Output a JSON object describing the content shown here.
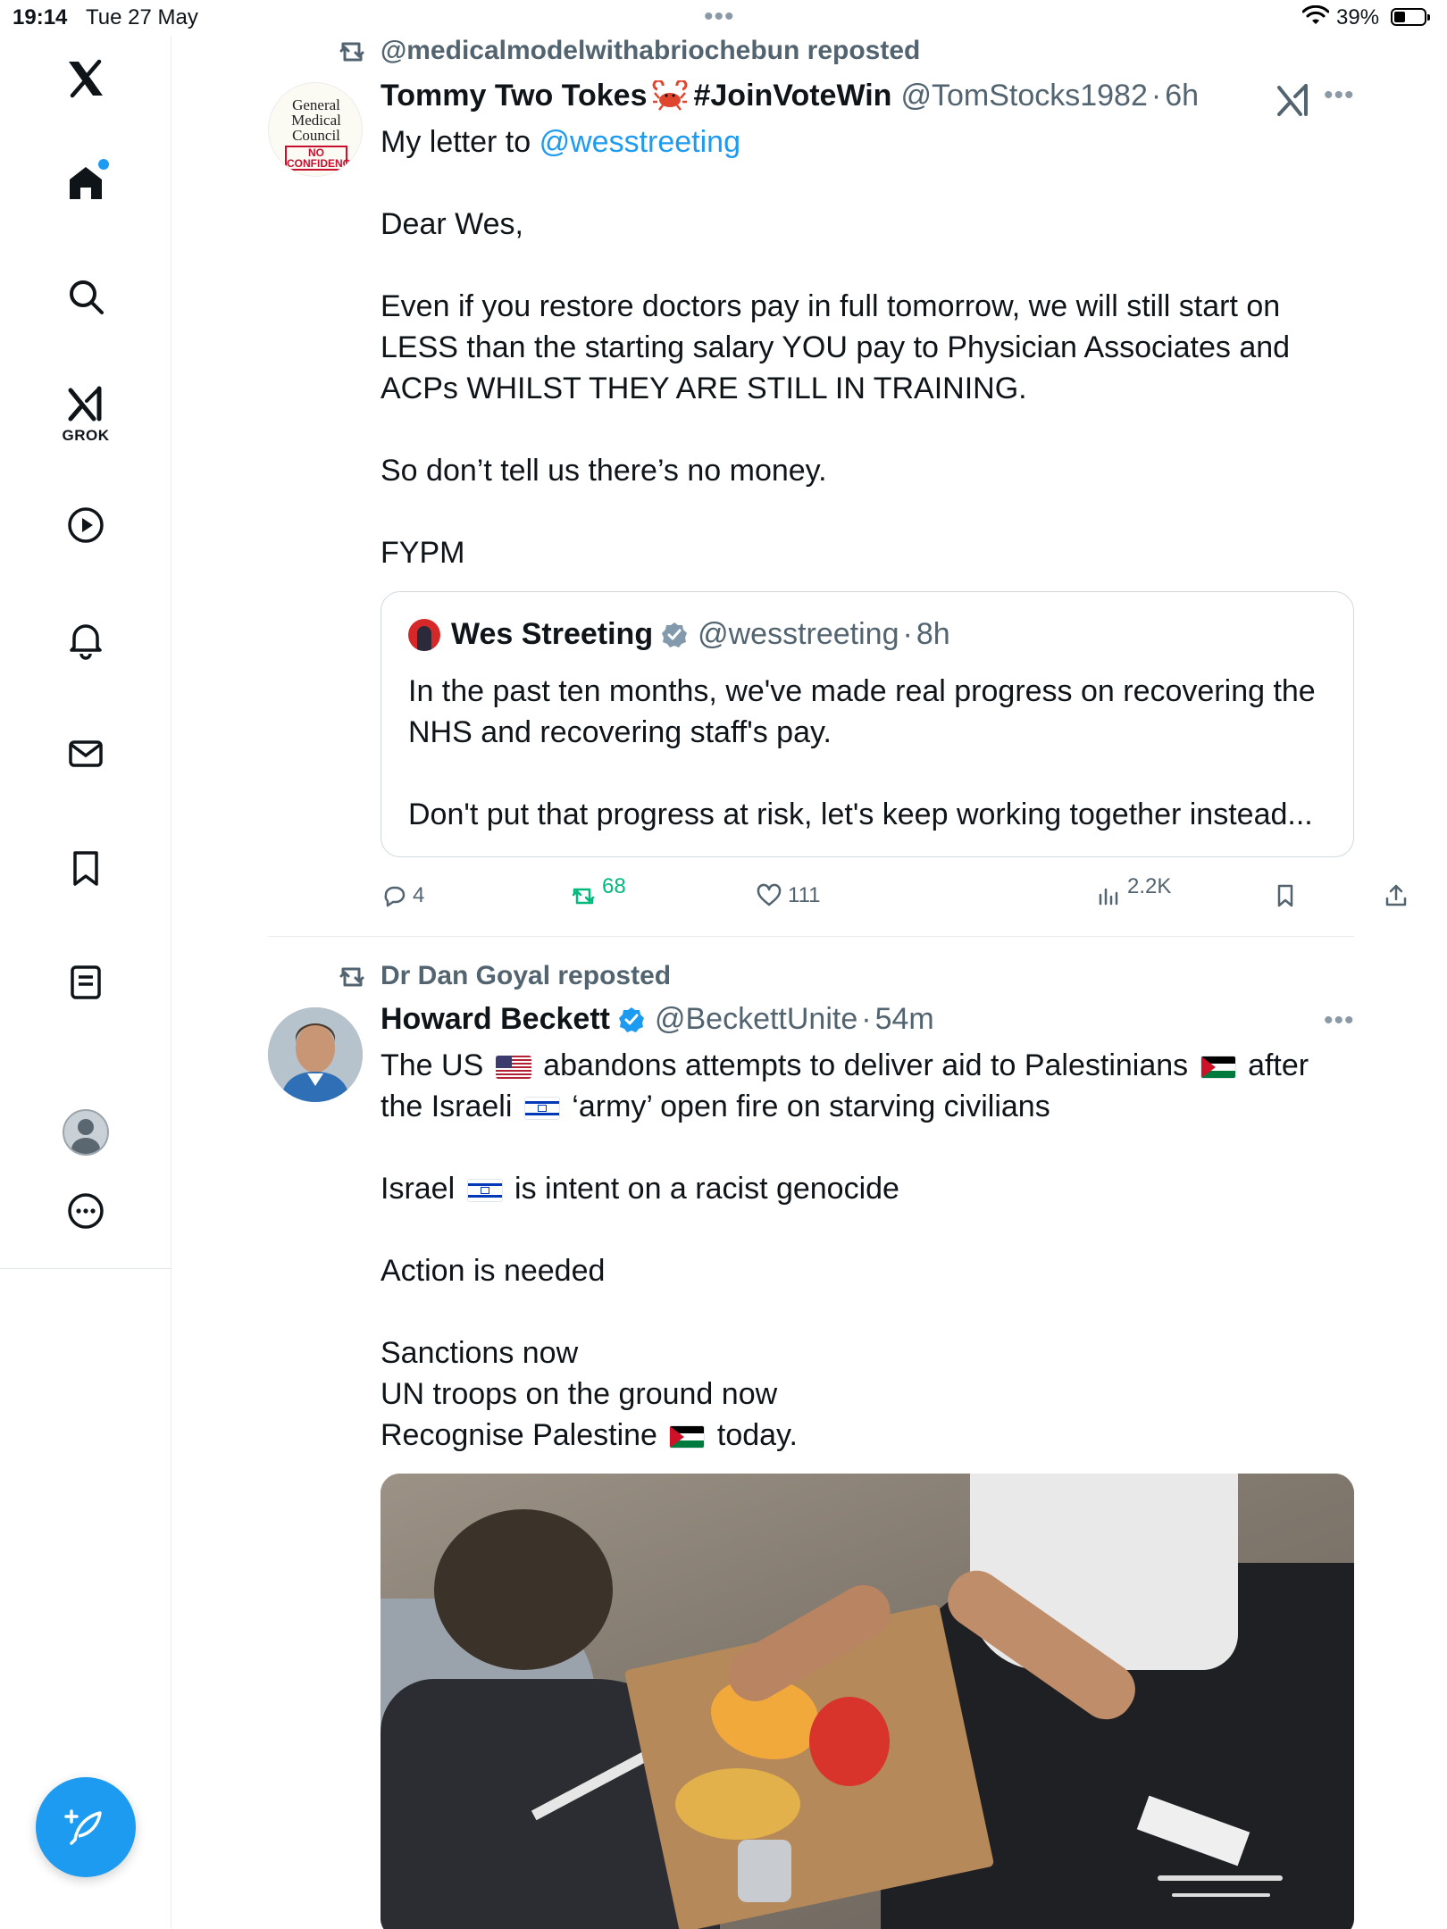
{
  "status_bar": {
    "time": "19:14",
    "date": "Tue 27 May",
    "battery_percent": "39%",
    "battery_level": 0.39
  },
  "sidebar": {
    "items": [
      {
        "name": "x-logo-icon"
      },
      {
        "name": "home-icon",
        "has_notification_dot": true
      },
      {
        "name": "search-icon"
      },
      {
        "name": "grok-icon",
        "label": "GROK"
      },
      {
        "name": "video-icon"
      },
      {
        "name": "notifications-icon"
      },
      {
        "name": "messages-icon"
      },
      {
        "name": "bookmarks-icon"
      },
      {
        "name": "lists-icon"
      },
      {
        "name": "profile-avatar"
      },
      {
        "name": "more-icon"
      }
    ],
    "compose_icon": "compose-feather-icon",
    "accent": "#1d9bf0"
  },
  "tweets": [
    {
      "repost_by": "@medicalmodelwithabriochebun reposted",
      "avatar_text": {
        "line1": "General",
        "line2": "Medical",
        "line3": "Council",
        "stamp1": "NO",
        "stamp2": "CONFIDENCE"
      },
      "author_name_part1": "Tommy Two Tokes",
      "author_name_part2": "#JoinVoteWin",
      "handle": "@TomStocks1982",
      "time": "6h",
      "body": {
        "line1_prefix": "My letter to ",
        "line1_mention": "@wesstreeting",
        "p2": "Dear Wes,",
        "p3": "Even if you restore doctors pay in full tomorrow, we will still start on LESS than the starting salary YOU pay to Physician Associates and ACPs WHILST THEY ARE STILL IN TRAINING.",
        "p4": "So don’t tell us there’s no money.",
        "p5": "FYPM"
      },
      "quote": {
        "author": "Wes Streeting",
        "handle": "@wesstreeting",
        "time": "8h",
        "p1": "In the past ten months, we've made real progress on recovering the NHS and recovering staff's pay.",
        "p2": "Don't put that progress at risk, let's keep working together instead..."
      },
      "stats": {
        "replies": "4",
        "reposts": "68",
        "likes": "111",
        "views": "2.2K"
      }
    },
    {
      "repost_by": "Dr Dan Goyal reposted",
      "author_name": "Howard Beckett",
      "handle": "@BeckettUnite",
      "time": "54m",
      "body": {
        "l1a": "The US ",
        "l1b": " abandons attempts to deliver aid to Palestinians ",
        "l1c": " after",
        "l2a": "the Israeli ",
        "l2b": " ‘army’ open fire on starving civilians",
        "p2a": "Israel ",
        "p2b": " is intent on a racist genocide",
        "p3": "Action is needed",
        "p4": "Sanctions now",
        "p5": "UN troops on the ground now",
        "p6a": "Recognise Palestine ",
        "p6b": " today."
      }
    }
  ]
}
